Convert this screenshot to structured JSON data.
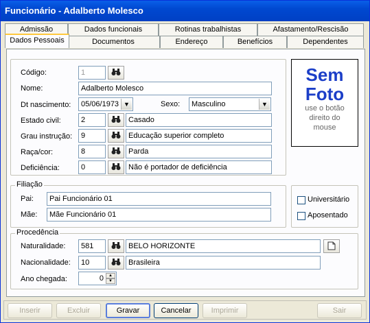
{
  "window": {
    "title": "Funcionário - Adalberto Molesco"
  },
  "tabs": {
    "row1": [
      "Admissão",
      "Dados funcionais",
      "Rotinas trabalhistas",
      "Afastamento/Rescisão"
    ],
    "row2": [
      "Dados Pessoais",
      "Documentos",
      "Endereço",
      "Benefícios",
      "Dependentes"
    ],
    "active": "Dados Pessoais"
  },
  "form": {
    "codigo": {
      "label": "Código:",
      "value": "1"
    },
    "nome": {
      "label": "Nome:",
      "value": "Adalberto Molesco"
    },
    "dt_nascimento": {
      "label": "Dt nascimento:",
      "value": "05/06/1973"
    },
    "sexo": {
      "label": "Sexo:",
      "value": "Masculino"
    },
    "estado_civil": {
      "label": "Estado civil:",
      "code": "2",
      "desc": "Casado"
    },
    "grau_instrucao": {
      "label": "Grau instrução:",
      "code": "9",
      "desc": "Educação superior completo"
    },
    "raca_cor": {
      "label": "Raça/cor:",
      "code": "8",
      "desc": "Parda"
    },
    "deficiencia": {
      "label": "Deficiência:",
      "code": "0",
      "desc": "Não é portador de deficiência"
    }
  },
  "photo": {
    "line1": "Sem",
    "line2": "Foto",
    "hint1": "use o botão",
    "hint2": "direito do",
    "hint3": "mouse"
  },
  "filiacao": {
    "title": "Filiação",
    "pai_label": "Pai:",
    "pai": "Pai Funcionário 01",
    "mae_label": "Mãe:",
    "mae": "Mãe Funcionário 01"
  },
  "flags": {
    "universitario": "Universitário",
    "aposentado": "Aposentado"
  },
  "procedencia": {
    "title": "Procedência",
    "naturalidade_label": "Naturalidade:",
    "naturalidade_code": "581",
    "naturalidade": "BELO HORIZONTE",
    "nacionalidade_label": "Nacionalidade:",
    "nacionalidade_code": "10",
    "nacionalidade": "Brasileira",
    "ano_label": "Ano chegada:",
    "ano": "0"
  },
  "buttons": {
    "inserir": "Inserir",
    "excluir": "Excluir",
    "gravar": "Gravar",
    "cancelar": "Cancelar",
    "imprimir": "Imprimir",
    "sair": "Sair"
  }
}
